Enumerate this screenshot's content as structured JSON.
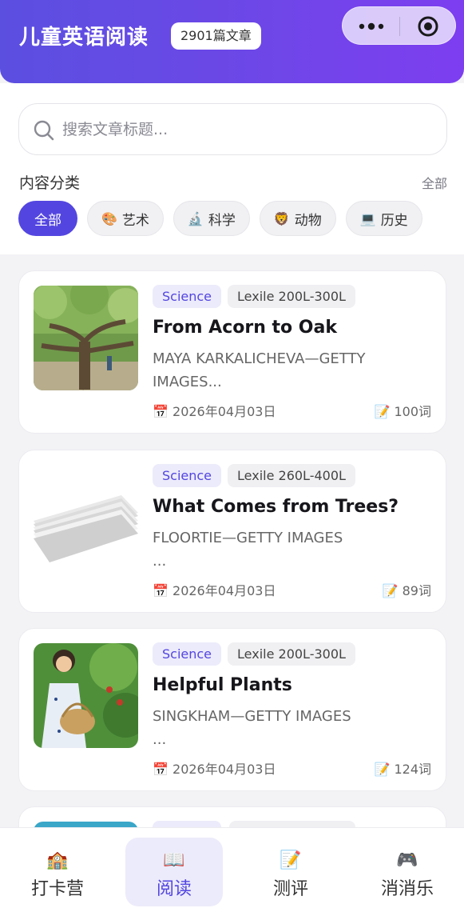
{
  "header": {
    "title": "儿童英语阅读",
    "count_badge": "2901篇文章",
    "more_icon": "more-dots-icon",
    "target_icon": "target-icon",
    "gradient": [
      "#5b4fe0",
      "#7d3ef0"
    ]
  },
  "search": {
    "placeholder": "搜索文章标题...",
    "icon": "search-icon"
  },
  "categories": {
    "title": "内容分类",
    "all_link": "全部",
    "chips": [
      {
        "label": "全部",
        "emoji": "",
        "active": true
      },
      {
        "label": "艺术",
        "emoji": "🎨",
        "active": false
      },
      {
        "label": "科学",
        "emoji": "🔬",
        "active": false
      },
      {
        "label": "动物",
        "emoji": "🦁",
        "active": false
      },
      {
        "label": "历史",
        "emoji": "💻",
        "active": false
      }
    ]
  },
  "articles": [
    {
      "subject": "Science",
      "lexile": "Lexile 200L-300L",
      "title": "From Acorn to Oak",
      "source": "MAYA KARKALICHEVA—GETTY\nIMAGES...",
      "date": "2026年04月03日",
      "date_icon": "📅",
      "words": "100词",
      "words_icon": "📝",
      "thumb": "tree-image"
    },
    {
      "subject": "Science",
      "lexile": "Lexile 260L-400L",
      "title": "What Comes from Trees?",
      "source": "FLOORTIE—GETTY IMAGES\n...",
      "date": "2026年04月03日",
      "date_icon": "📅",
      "words": "89词",
      "words_icon": "📝",
      "thumb": "paper-stack-image"
    },
    {
      "subject": "Science",
      "lexile": "Lexile 200L-300L",
      "title": "Helpful Plants",
      "source": "SINGKHAM—GETTY IMAGES\n...",
      "date": "2026年04月03日",
      "date_icon": "📅",
      "words": "124词",
      "words_icon": "📝",
      "thumb": "girl-garden-image"
    }
  ],
  "nav": [
    {
      "label": "打卡营",
      "icon": "🏫",
      "active": false
    },
    {
      "label": "阅读",
      "icon": "📖",
      "active": true
    },
    {
      "label": "测评",
      "icon": "📝",
      "active": false
    },
    {
      "label": "消消乐",
      "icon": "🎮",
      "active": false
    }
  ],
  "colors": {
    "accent": "#5346e0",
    "accent_light": "#ecebfb"
  }
}
